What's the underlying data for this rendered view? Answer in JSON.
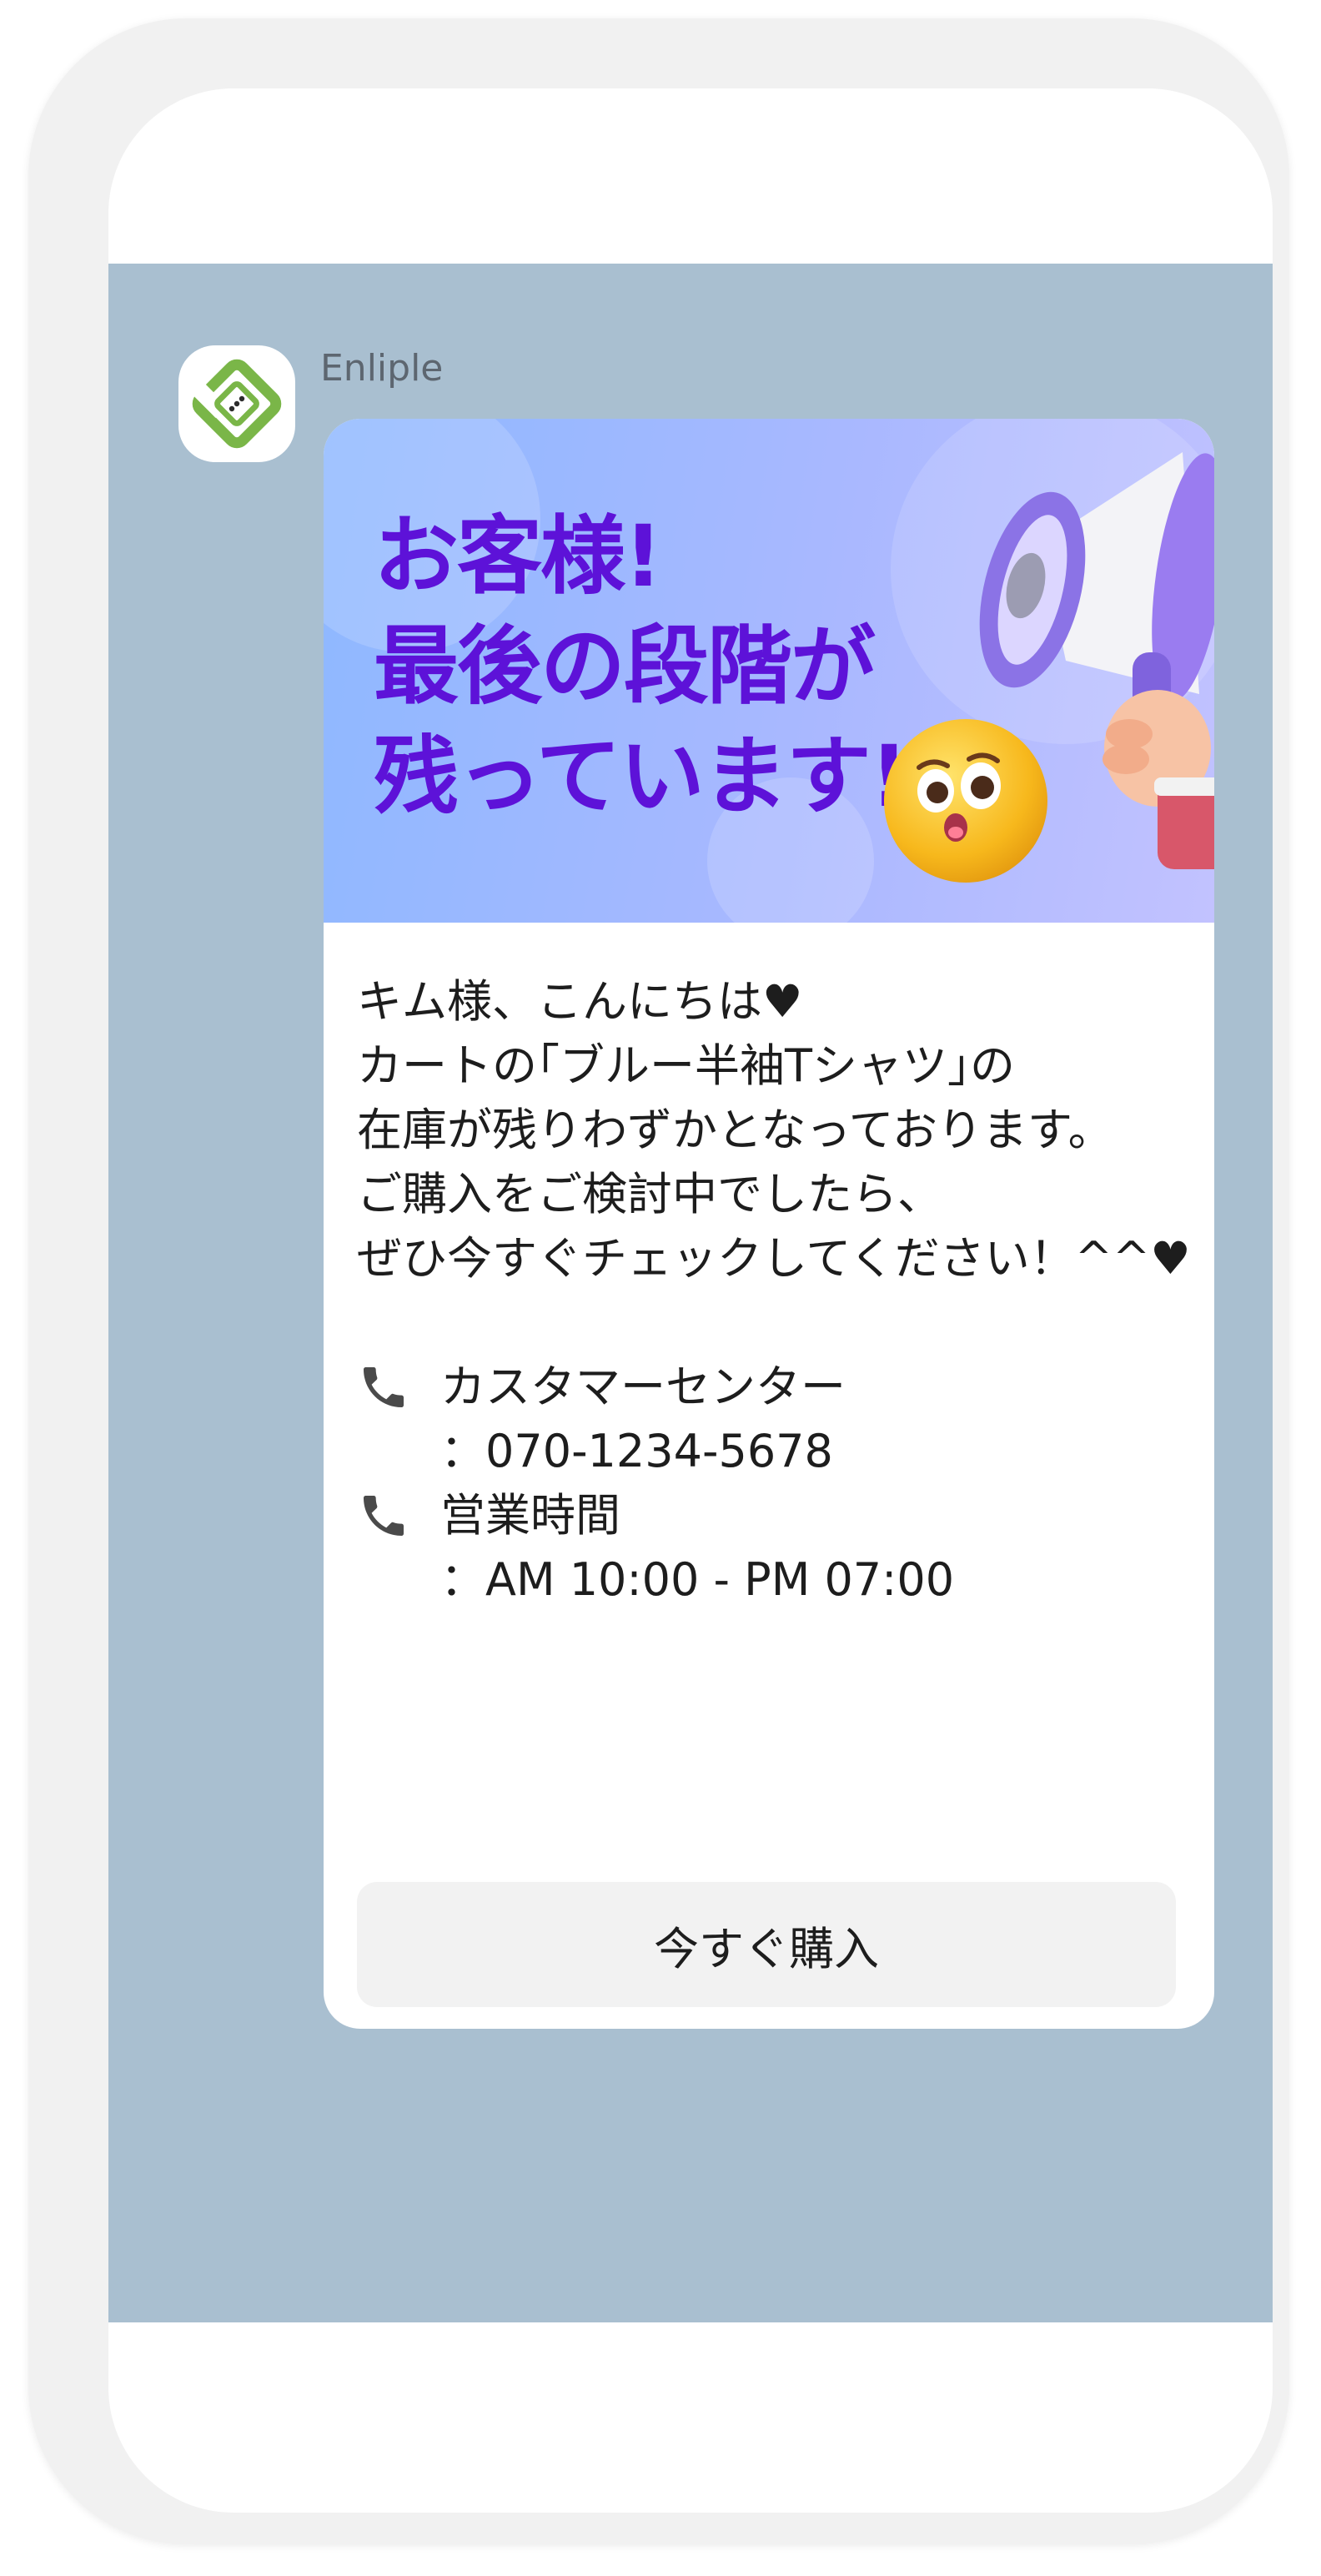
{
  "chat": {
    "sender_name": "Enliple"
  },
  "banner": {
    "title_lines": [
      "お客様!",
      "最後の段階が",
      "残っています!"
    ]
  },
  "message": {
    "lines": [
      "キム様、こんにちは♥",
      "カートの｢ブルー半袖Tシャツ｣の",
      "在庫が残りわずかとなっております。",
      "ご購入をご検討中でしたら、",
      "ぜひ今すぐチェックしてください！^^♥"
    ],
    "contacts": [
      {
        "icon": "phone-icon",
        "label": "カスタマーセンター",
        "value": "：070-1234-5678"
      },
      {
        "icon": "phone-icon",
        "label": "営業時間",
        "value": "：AM 10:00 - PM 07:00"
      }
    ]
  },
  "button": {
    "buy_label": "今すぐ購入"
  },
  "colors": {
    "chat_background": "#a9bfd0",
    "banner_title": "#5d12d8",
    "logo_green": "#7ab648"
  }
}
